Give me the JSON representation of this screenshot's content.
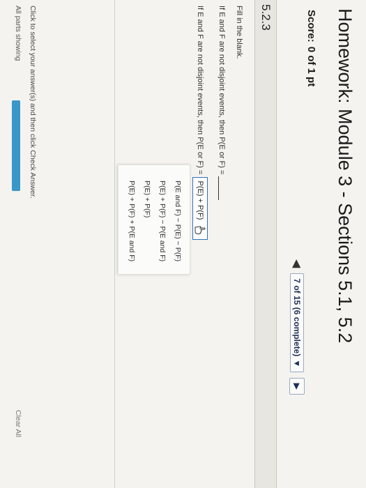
{
  "header": {
    "title": "Homework: Module 3 - Sections 5.1, 5.2",
    "score_label": "Score:",
    "score_value": "0 of 1 pt"
  },
  "nav": {
    "prev_icon": "triangle-left",
    "counter": "7 of 15 (6 complete)",
    "dropdown_icon": "triangle-down",
    "next_icon": "triangle-right"
  },
  "section": {
    "id": "5.2.3"
  },
  "question": {
    "instruction": "Fill in the blank.",
    "prompt": "If E and F are not disjoint events, then P(E or F) =",
    "answer_prefix": "If E and F are not disjoint events, then P(E or F) =",
    "selected_answer": "P(E) + P(F)",
    "cursor_icon": "hand-pointer-icon"
  },
  "options": [
    "P(E and F) − P(E) − P(F)",
    "P(E) + P(F) − P(E and F)",
    "P(E) + P(F)",
    "P(E) + P(F) + P(E and F)"
  ],
  "footer": {
    "hint": "Click to select your answer(s) and then click Check Answer.",
    "parts_status": "All parts showing",
    "progress": 1.0,
    "clear_all": "Clear All"
  },
  "colors": {
    "accent": "#2f6fb8",
    "progress": "#3a97c9",
    "background": "#f4f3ef"
  }
}
